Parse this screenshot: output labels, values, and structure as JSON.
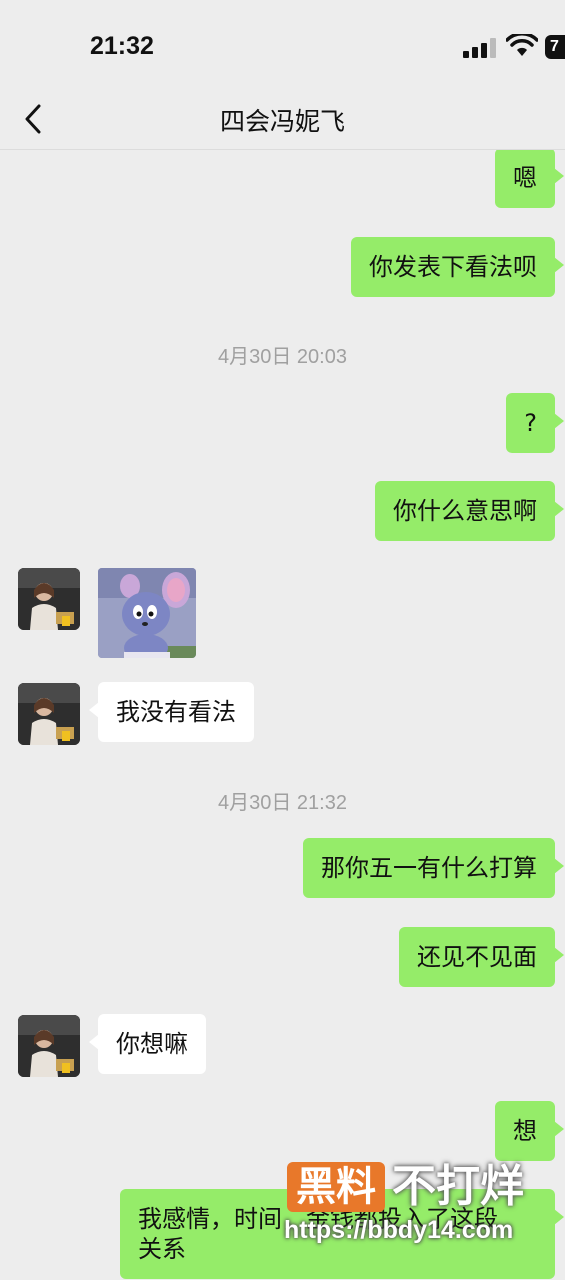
{
  "status_bar": {
    "time": "21:32",
    "battery": "7"
  },
  "nav": {
    "title": "四会冯妮飞"
  },
  "messages": [
    {
      "side": "me",
      "text": "嗯"
    },
    {
      "side": "me",
      "text": "你发表下看法呗"
    },
    {
      "type": "timestamp",
      "text": "4月30日 20:03"
    },
    {
      "side": "me",
      "text": "?"
    },
    {
      "side": "me",
      "text": "你什么意思啊"
    },
    {
      "side": "them",
      "type": "sticker",
      "icon": "cartoon-mouse-sticker"
    },
    {
      "side": "them",
      "text": "我没有看法"
    },
    {
      "type": "timestamp",
      "text": "4月30日 21:32"
    },
    {
      "side": "me",
      "text": "那你五一有什么打算"
    },
    {
      "side": "me",
      "text": "还见不见面"
    },
    {
      "side": "them",
      "text": "你想嘛"
    },
    {
      "side": "me",
      "text": "想"
    },
    {
      "side": "me",
      "text_line1": "我感情，时间，金钱都投入了这段",
      "text_line2": "关系"
    }
  ],
  "watermark": {
    "logo": "黑料",
    "name": "不打烊",
    "url": "https://bbdy14.com"
  },
  "colors": {
    "my_bubble": "#95ec69",
    "their_bubble": "#ffffff",
    "background": "#ededed",
    "watermark_accent": "#e8782a"
  }
}
